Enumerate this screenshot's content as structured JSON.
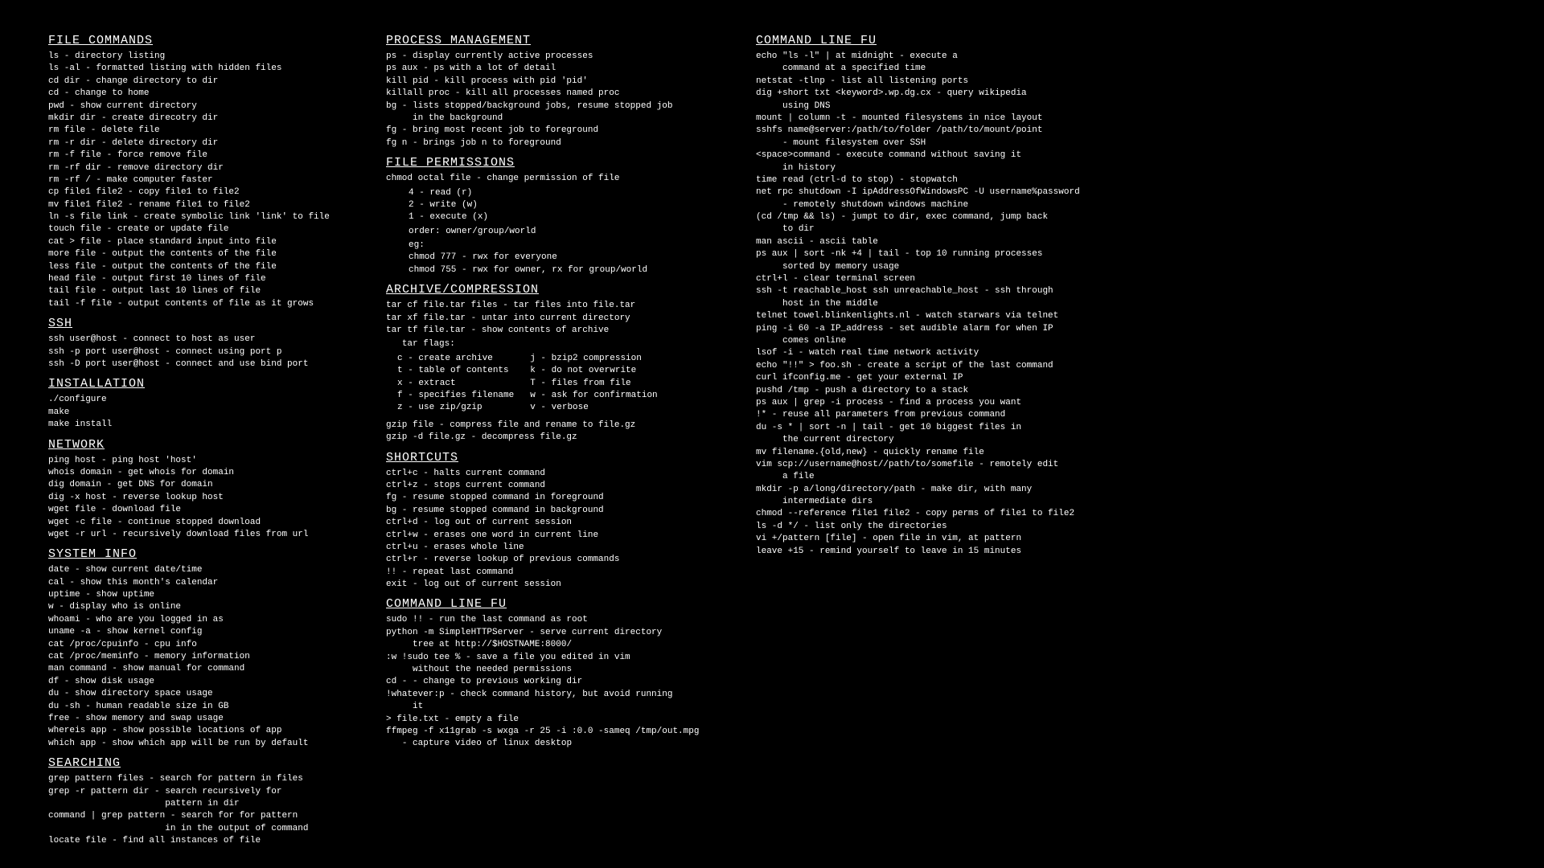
{
  "col1": {
    "s1_title": "FILE COMMANDS",
    "s1_lines": [
      "ls - directory listing",
      "ls -al - formatted listing with hidden files",
      "cd dir - change directory to dir",
      "cd - change to home",
      "pwd - show current directory",
      "mkdir dir - create direcotry dir",
      "rm file - delete file",
      "rm -r dir - delete directory dir",
      "rm -f file - force remove file",
      "rm -rf dir - remove directory dir",
      "rm -rf / - make computer faster",
      "cp file1 file2 - copy file1 to file2",
      "mv file1 file2 - rename file1 to file2",
      "ln -s file link - create symbolic link 'link' to file",
      "touch file - create or update file",
      "cat > file - place standard input into file",
      "more file - output the contents of the file",
      "less file - output the contents of the file",
      "head file - output first 10 lines of file",
      "tail file - output last 10 lines of file",
      "tail -f file - output contents of file as it grows"
    ],
    "s2_title": "SSH",
    "s2_lines": [
      "ssh user@host - connect to host as user",
      "ssh -p port user@host - connect using port p",
      "ssh -D port user@host - connect and use bind port"
    ],
    "s3_title": "INSTALLATION",
    "s3_lines": [
      "./configure",
      "make",
      "make install"
    ],
    "s4_title": "NETWORK",
    "s4_lines": [
      "ping host - ping host 'host'",
      "whois domain - get whois for domain",
      "dig domain - get DNS for domain",
      "dig -x host - reverse lookup host",
      "wget file - download file",
      "wget -c file - continue stopped download",
      "wget -r url - recursively download files from url"
    ],
    "s5_title": "SYSTEM INFO",
    "s5_lines": [
      "date - show current date/time",
      "cal - show this month's calendar",
      "uptime - show uptime",
      "w - display who is online",
      "whoami - who are you logged in as",
      "uname -a - show kernel config",
      "cat /proc/cpuinfo - cpu info",
      "cat /proc/meminfo - memory information",
      "man command - show manual for command",
      "df - show disk usage",
      "du - show directory space usage",
      "du -sh - human readable size in GB",
      "free - show memory and swap usage",
      "whereis app - show possible locations of app",
      "which app - show which app will be run by default"
    ],
    "s6_title": "SEARCHING",
    "s6_lines": [
      "grep pattern files - search for pattern in files",
      "grep -r pattern dir - search recursively for\n                      pattern in dir",
      "command | grep pattern - search for for pattern\n                      in in the output of command",
      "locate file - find all instances of file"
    ]
  },
  "col2": {
    "s1_title": "PROCESS MANAGEMENT",
    "s1_lines": [
      "ps - display currently active processes",
      "ps aux - ps with a lot of detail",
      "kill pid - kill process with pid 'pid'",
      "killall proc - kill all processes named proc",
      "bg - lists stopped/background jobs, resume stopped job\n     in the background",
      "fg - bring most recent job to foreground",
      "fg n - brings job n to foreground"
    ],
    "s2_title": "FILE PERMISSIONS",
    "s2_a": "chmod octal file - change permission of file",
    "s2_b": "4 - read (r)\n2 - write (w)\n1 - execute (x)",
    "s2_c": "order: owner/group/world",
    "s2_d": "eg:\nchmod 777 - rwx for everyone\nchmod 755 - rwx for owner, rx for group/world",
    "s3_title": "ARCHIVE/COMPRESSION",
    "s3_a": [
      "tar cf file.tar files - tar files into file.tar",
      "tar xf file.tar - untar into current directory",
      "tar tf file.tar - show contents of archive"
    ],
    "s3_flags_label": "   tar flags:",
    "s3_flags_left": "c - create archive\nt - table of contents\nx - extract\nf - specifies filename\nz - use zip/gzip",
    "s3_flags_right": "j - bzip2 compression\nk - do not overwrite\nT - files from file\nw - ask for confirmation\nv - verbose",
    "s3_b": [
      "gzip file - compress file and rename to file.gz",
      "gzip -d file.gz - decompress file.gz"
    ],
    "s4_title": "SHORTCUTS",
    "s4_lines": [
      "ctrl+c - halts current command",
      "ctrl+z - stops current command",
      "fg - resume stopped command in foreground",
      "bg - resume stopped command in background",
      "ctrl+d - log out of current session",
      "ctrl+w - erases one word in current line",
      "ctrl+u - erases whole line",
      "ctrl+r - reverse lookup of previous commands",
      "!! - repeat last command",
      "exit - log out of current session"
    ],
    "s5_title": "COMMAND LINE FU",
    "s5_lines": [
      "sudo !! - run the last command as root",
      "python -m SimpleHTTPServer - serve current directory\n     tree at http://$HOSTNAME:8000/",
      ":w !sudo tee % - save a file you edited in vim\n     without the needed permissions",
      "cd - - change to previous working dir",
      "!whatever:p - check command history, but avoid running\n     it",
      "> file.txt - empty a file",
      "ffmpeg -f x11grab -s wxga -r 25 -i :0.0 -sameq /tmp/out.mpg\n   - capture video of linux desktop"
    ]
  },
  "col3": {
    "s1_title": "COMMAND LINE FU",
    "s1_lines": [
      "echo \"ls -l\" | at midnight - execute a\n     command at a specified time",
      "netstat -tlnp - list all listening ports",
      "dig +short txt <keyword>.wp.dg.cx - query wikipedia\n     using DNS",
      "mount | column -t - mounted filesystems in nice layout",
      "sshfs name@server:/path/to/folder /path/to/mount/point\n     - mount filesystem over SSH",
      "<space>command - execute command without saving it\n     in history",
      "time read (ctrl-d to stop) - stopwatch",
      "net rpc shutdown -I ipAddressOfWindowsPC -U username%password\n     - remotely shutdown windows machine",
      "(cd /tmp && ls) - jumpt to dir, exec command, jump back\n     to dir",
      "man ascii - ascii table",
      "ps aux | sort -nk +4 | tail - top 10 running processes\n     sorted by memory usage",
      "ctrl+l - clear terminal screen",
      "ssh -t reachable_host ssh unreachable_host - ssh through\n     host in the middle",
      "telnet towel.blinkenlights.nl - watch starwars via telnet",
      "ping -i 60 -a IP_address - set audible alarm for when IP\n     comes online",
      "lsof -i - watch real time network activity",
      "echo \"!!\" > foo.sh - create a script of the last command",
      "curl ifconfig.me - get your external IP",
      "pushd /tmp - push a directory to a stack",
      "ps aux | grep -i process - find a process you want",
      "!* - reuse all parameters from previous command",
      "du -s * | sort -n | tail - get 10 biggest files in\n     the current directory",
      "mv filename.{old,new} - quickly rename file",
      "vim scp://username@host//path/to/somefile - remotely edit\n     a file",
      "mkdir -p a/long/directory/path - make dir, with many\n     intermediate dirs",
      "chmod --reference file1 file2 - copy perms of file1 to file2",
      "ls -d */ - list only the directories",
      "vi +/pattern [file] - open file in vim, at pattern",
      "leave +15 - remind yourself to leave in 15 minutes"
    ]
  }
}
